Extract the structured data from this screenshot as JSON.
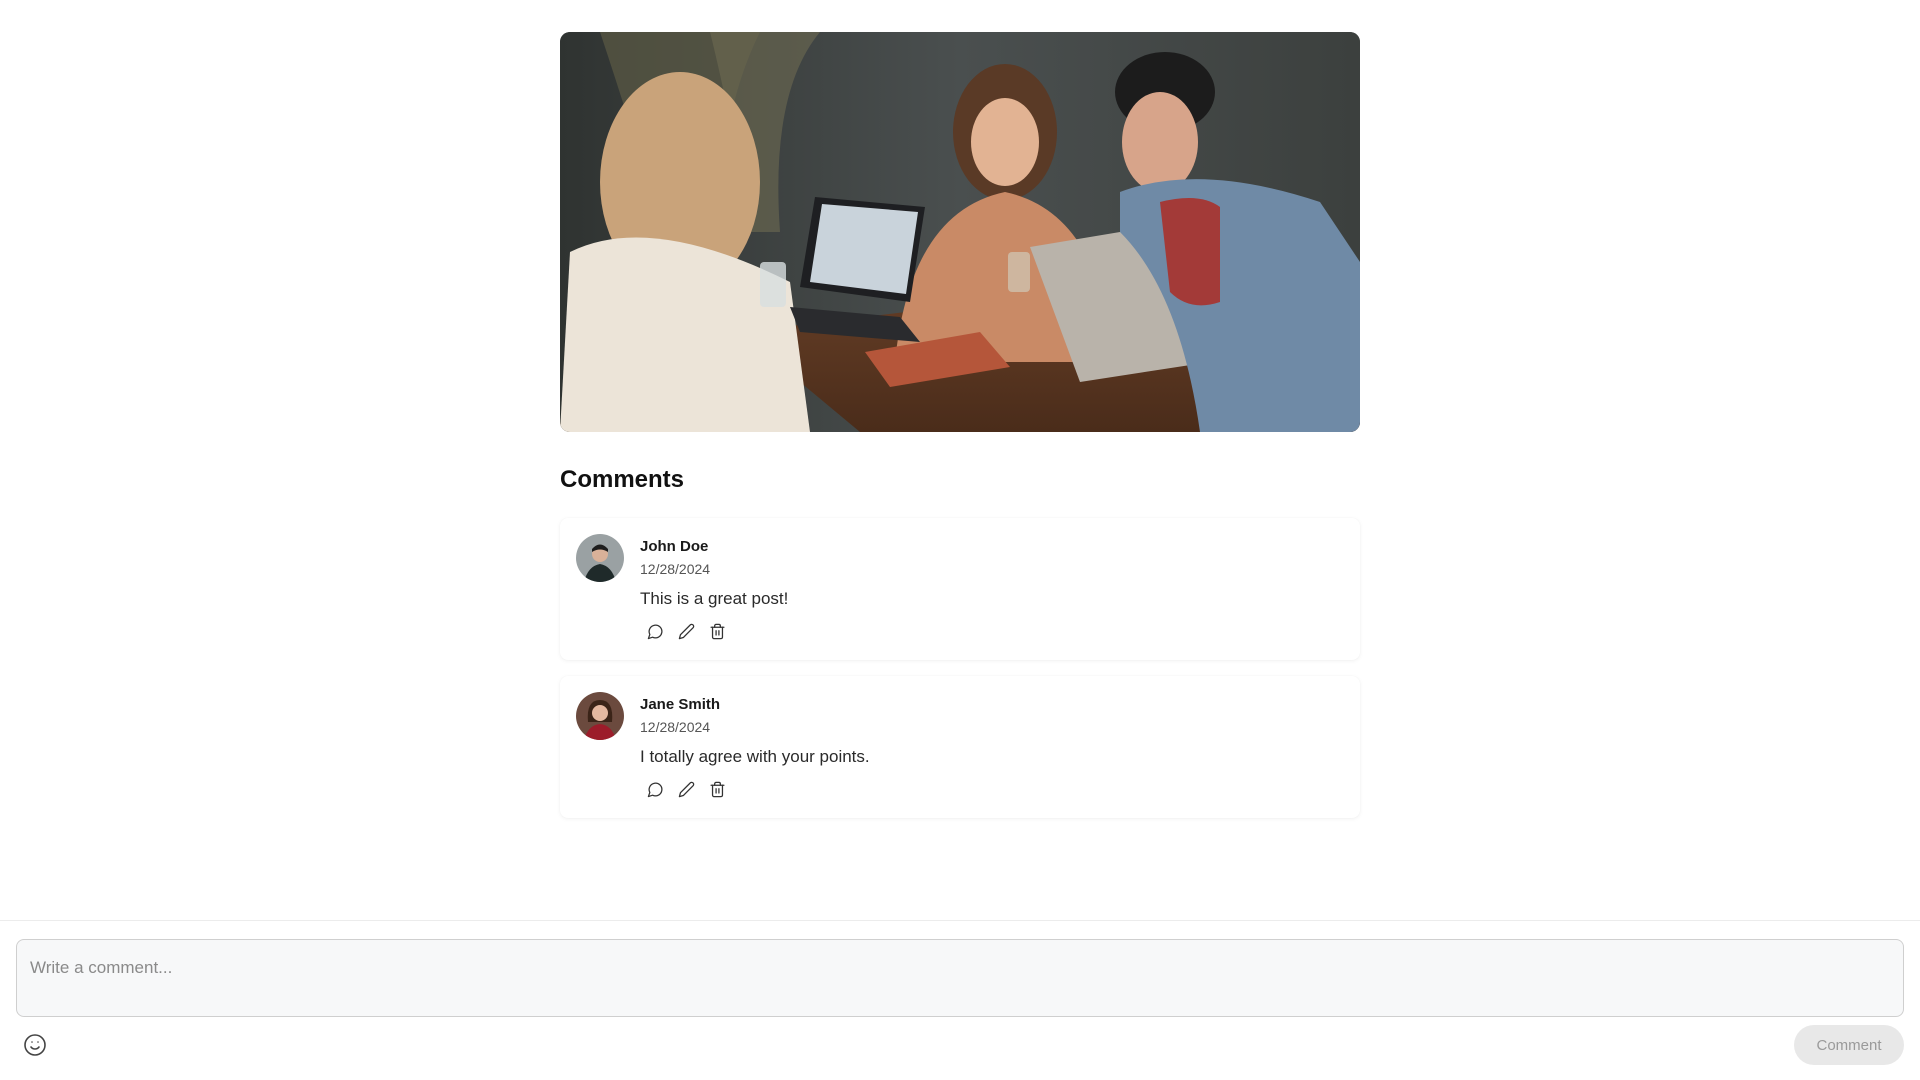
{
  "post": {
    "image_alt": "Three people laughing at a cafe table with laptops"
  },
  "comments_section": {
    "title": "Comments",
    "items": [
      {
        "author": "John Doe",
        "date": "12/28/2024",
        "text": "This is a great post!",
        "avatar_icon": "avatar-man"
      },
      {
        "author": "Jane Smith",
        "date": "12/28/2024",
        "text": "I totally agree with your points.",
        "avatar_icon": "avatar-woman"
      }
    ],
    "actions": [
      "reply-icon",
      "edit-icon",
      "delete-icon"
    ]
  },
  "composer": {
    "placeholder": "Write a comment...",
    "value": "",
    "emoji_icon": "emoji-icon",
    "submit_label": "Comment"
  },
  "colors": {
    "submit_disabled_bg": "#e8e8e8",
    "submit_disabled_text": "#9a9a9a",
    "input_bg": "#f7f8f9"
  }
}
